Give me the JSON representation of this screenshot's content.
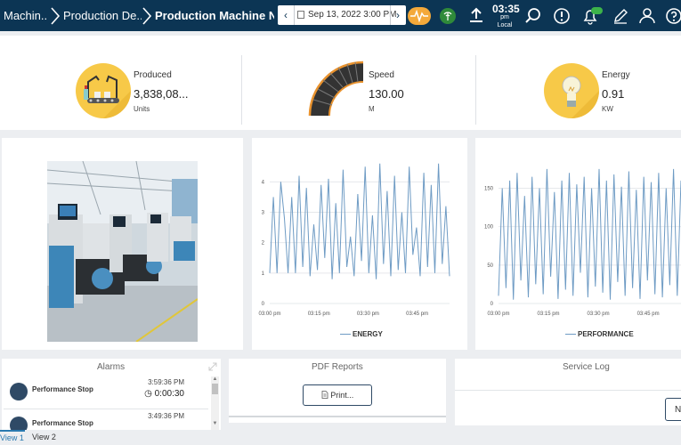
{
  "header": {
    "breadcrumbs": [
      "Machin...",
      "Production De...",
      "Production Machine Niv..."
    ],
    "date_value": "Sep 13, 2022 3:00 PM",
    "clock": {
      "time": "03:35",
      "period": "pm",
      "zone": "Local"
    },
    "icons": [
      "chevron-left-icon",
      "calendar-icon",
      "chevron-right-icon",
      "heartbeat-icon",
      "signal-icon",
      "upload-icon",
      "search-icon",
      "alert-icon",
      "notification-icon",
      "edit-icon",
      "user-icon",
      "help-icon"
    ],
    "notification_badge": "",
    "colors": {
      "bar": "#0c3554",
      "accent": "#f4c542",
      "series": "#6e9bc4"
    }
  },
  "kpis": [
    {
      "title": "Produced",
      "value": "3,838,08...",
      "unit": "Units",
      "icon": "production-line-icon"
    },
    {
      "title": "Speed",
      "value": "130.00",
      "unit": "M",
      "icon": "speed-gauge-icon"
    },
    {
      "title": "Energy",
      "value": "0.91",
      "unit": "KW",
      "icon": "light-bulb-icon"
    }
  ],
  "charts": {
    "chart_data": [
      {
        "type": "line",
        "series": [
          {
            "name": "ENERGY",
            "values": [
              1,
              3.5,
              1,
              4,
              2.8,
              1,
              3.5,
              1,
              4.2,
              1.2,
              3.8,
              0.9,
              2.6,
              1.1,
              3.9,
              1.5,
              4.1,
              0.8,
              3.3,
              1,
              4.4,
              1.2,
              2.2,
              0.9,
              3.6,
              1.4,
              4.5,
              1,
              2.9,
              0.8,
              4.6,
              1.3,
              3.7,
              0.9,
              4.2,
              1.1,
              3,
              1,
              4.5,
              1.6,
              2.5,
              0.9,
              4.3,
              1.2,
              3.9,
              1,
              4.6,
              1.3,
              3.2,
              0.9
            ]
          }
        ],
        "x_ticks": [
          "03:00 pm",
          "03:15 pm",
          "03:30 pm",
          "03:45 pm"
        ],
        "y_ticks": [
          "0",
          "1",
          "2",
          "3",
          "4"
        ],
        "ylim": [
          0,
          4.8
        ],
        "legend": "bottom-center",
        "grid": true
      },
      {
        "type": "line",
        "series": [
          {
            "name": "PERFORMANCE",
            "values": [
              10,
              150,
              20,
              160,
              5,
              170,
              30,
              140,
              8,
              165,
              25,
              150,
              12,
              175,
              35,
              145,
              6,
              160,
              18,
              170,
              10,
              155,
              40,
              165,
              8,
              150,
              22,
              175,
              14,
              160,
              5,
              168,
              28,
              152,
              10,
              172,
              20,
              148,
              6,
              165,
              30,
              158,
              12,
              170,
              8,
              150,
              24,
              175,
              10,
              160
            ]
          }
        ],
        "x_ticks": [
          "03:00 pm",
          "03:15 pm",
          "03:30 pm",
          "03:45 pm"
        ],
        "y_ticks": [
          "0",
          "50",
          "100",
          "150"
        ],
        "ylim": [
          0,
          190
        ],
        "legend": "bottom-center",
        "grid": true
      }
    ]
  },
  "alarms": {
    "title": "Alarms",
    "items": [
      {
        "name": "Performance Stop",
        "time": "3:59:36 PM",
        "duration": "0:00:30"
      },
      {
        "name": "Performance Stop",
        "time": "3:49:36 PM",
        "duration": ""
      }
    ]
  },
  "pdf_reports": {
    "title": "PDF Reports",
    "print_label": "Print..."
  },
  "service_log": {
    "title": "Service Log",
    "button_label": "N"
  },
  "tabs": [
    "View 1",
    "View 2"
  ]
}
